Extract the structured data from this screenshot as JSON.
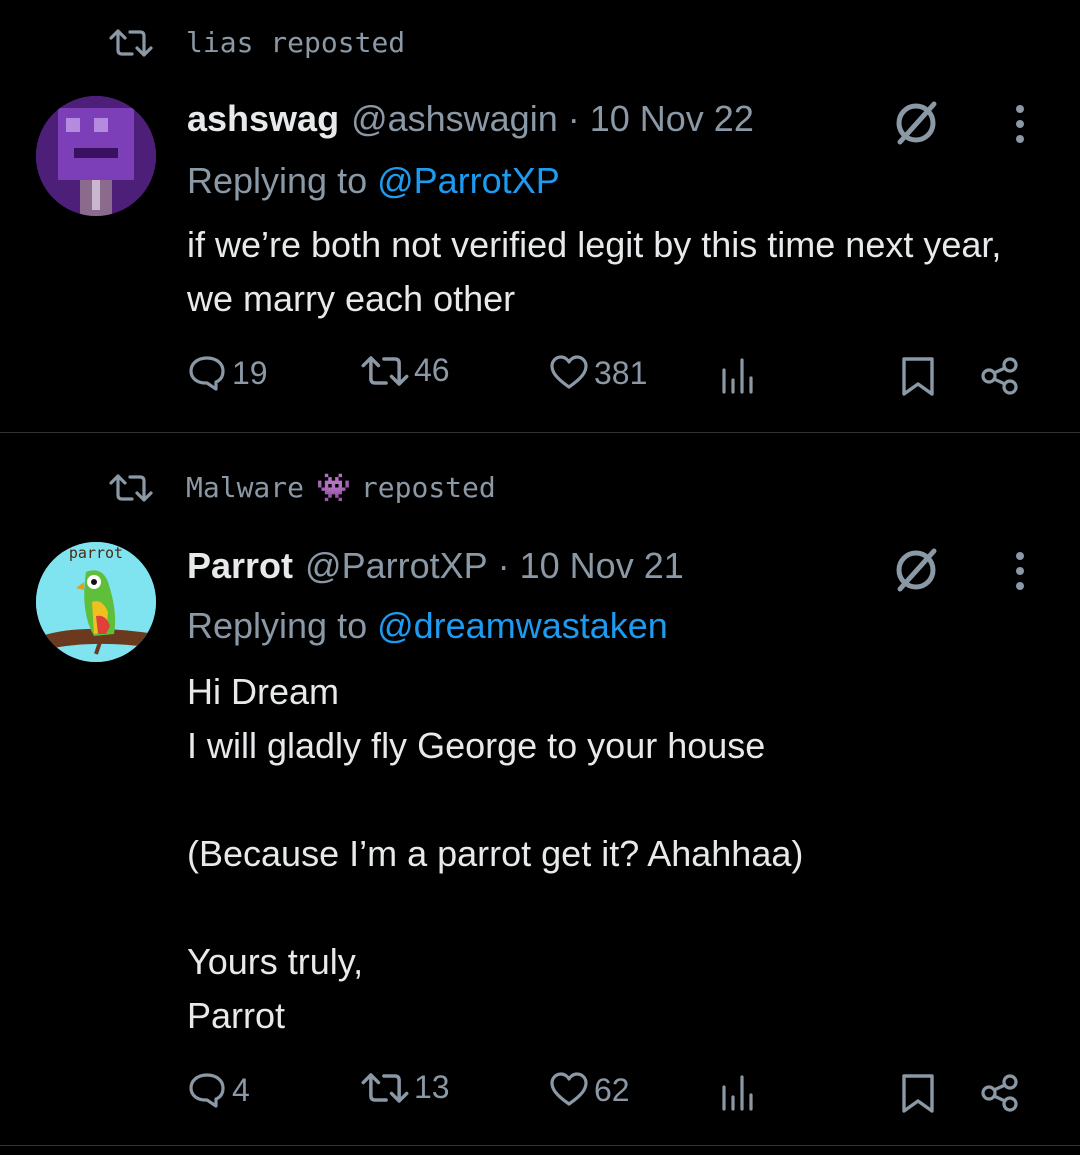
{
  "tweets": [
    {
      "repost_by": "lias",
      "repost_suffix": "reposted",
      "display_name": "ashswag",
      "handle": "@ashswagin",
      "separator": "·",
      "date": "10 Nov 22",
      "replying_prefix": "Replying to",
      "replying_to": "@ParrotXP",
      "body": "if we’re both not verified legit by this time next year, we marry each other",
      "replies": "19",
      "reposts": "46",
      "likes": "381"
    },
    {
      "repost_by": "Malware",
      "repost_emoji": "👾",
      "repost_suffix": "reposted",
      "display_name": "Parrot",
      "handle": "@ParrotXP",
      "separator": "·",
      "date": "10 Nov 21",
      "replying_prefix": "Replying to",
      "replying_to": "@dreamwastaken",
      "body_lines": [
        "Hi Dream",
        "I will gladly fly George to your house",
        "",
        "(Because I’m a parrot get it? Ahahhaa)",
        "",
        "Yours truly,",
        "Parrot"
      ],
      "avatar_text": "parrot",
      "replies": "4",
      "reposts": "13",
      "likes": "62"
    }
  ],
  "icons": {
    "repost": "repost-icon",
    "reply": "reply-icon",
    "like": "heart-icon",
    "views": "views-icon",
    "bookmark": "bookmark-icon",
    "share": "share-icon",
    "grok": "grok-icon",
    "more": "more-icon"
  },
  "colors": {
    "background": "#000000",
    "text": "#e7e9ea",
    "secondary": "#8b98a5",
    "link": "#1d9bf0",
    "divider": "#2f3336"
  }
}
